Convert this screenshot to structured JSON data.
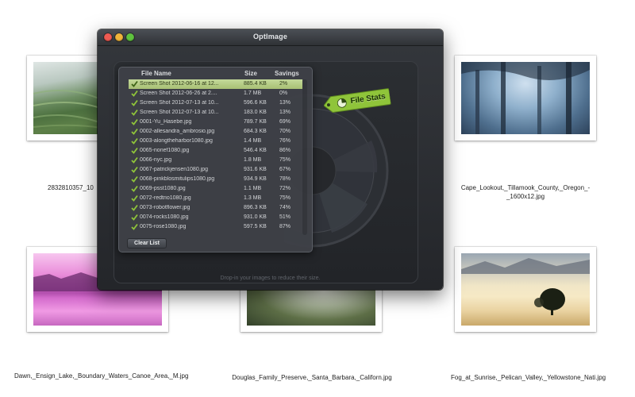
{
  "window": {
    "title": "OptImage"
  },
  "dropzone": {
    "hint": "Drop-in your images to reduce their size."
  },
  "file_stats": {
    "label": "File Stats"
  },
  "table": {
    "columns": {
      "name": "File Name",
      "size": "Size",
      "savings": "Savings"
    },
    "rows": [
      {
        "name": "Screen Shot 2012-06-16 at 12...",
        "size": "885.4 KB",
        "savings": "2%",
        "selected": true
      },
      {
        "name": "Screen Shot 2012-06-26 at 2....",
        "size": "1.7 MB",
        "savings": "0%"
      },
      {
        "name": "Screen Shot 2012-07-13 at 10...",
        "size": "596.6 KB",
        "savings": "13%"
      },
      {
        "name": "Screen Shot 2012-07-13 at 10...",
        "size": "183.0 KB",
        "savings": "13%"
      },
      {
        "name": "0001-Yu_Hasebe.jpg",
        "size": "789.7 KB",
        "savings": "69%"
      },
      {
        "name": "0002-allesandra_ambrosio.jpg",
        "size": "684.3 KB",
        "savings": "70%"
      },
      {
        "name": "0003-alongtheharbor1080.jpg",
        "size": "1.4 MB",
        "savings": "76%"
      },
      {
        "name": "0065-nonef1080.jpg",
        "size": "546.4 KB",
        "savings": "86%"
      },
      {
        "name": "0066-nyc.jpg",
        "size": "1.8 MB",
        "savings": "75%"
      },
      {
        "name": "0067-patrickjensen1080.jpg",
        "size": "931.6 KB",
        "savings": "67%"
      },
      {
        "name": "0068-pinkblosmitulips1080.jpg",
        "size": "934.9 KB",
        "savings": "78%"
      },
      {
        "name": "0069-psst1080.jpg",
        "size": "1.1 MB",
        "savings": "72%"
      },
      {
        "name": "0072-redtrio1080.jpg",
        "size": "1.3 MB",
        "savings": "75%"
      },
      {
        "name": "0073-robotflower.jpg",
        "size": "896.3 KB",
        "savings": "74%"
      },
      {
        "name": "0074-rocks1080.jpg",
        "size": "931.0 KB",
        "savings": "51%"
      },
      {
        "name": "0075-rose1080.jpg",
        "size": "597.5 KB",
        "savings": "87%"
      }
    ]
  },
  "buttons": {
    "clear_list": "Clear List"
  },
  "desktop": {
    "files": [
      {
        "caption": "2832810357_10",
        "scene": "rice-terraces"
      },
      {
        "caption": "Cape_Lookout,_Tillamook_County,_Oregon_-_1600x12.jpg",
        "scene": "misty-forest"
      },
      {
        "caption": "Dawn,_Ensign_Lake,_Boundary_Waters_Canoe_Area,_M.jpg",
        "scene": "purple-lake"
      },
      {
        "caption": "Douglas_Family_Preserve,_Santa_Barbara,_Californ.jpg",
        "scene": "forest-path"
      },
      {
        "caption": "Fog_at_Sunrise,_Pelican_Valley,_Yellowstone_Nati.jpg",
        "scene": "foggy-valley"
      }
    ]
  },
  "colors": {
    "accent_green": "#8fc43a",
    "selected_row": "#b5cc86",
    "window_bg": "#2b2e32",
    "close": "#ee5a52",
    "minimize": "#f0b43a",
    "zoom": "#5fc23e"
  }
}
